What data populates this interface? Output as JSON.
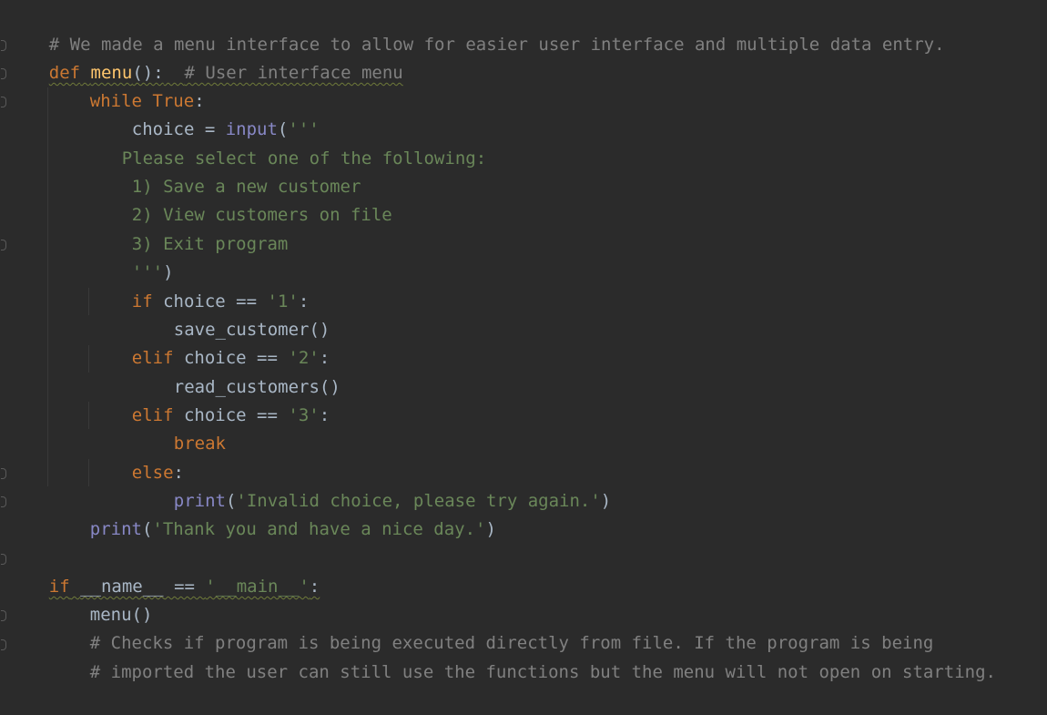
{
  "code": {
    "comment_top": "# We made a menu interface to allow for easier user interface and multiple data entry.",
    "def_kw": "def",
    "def_name": "menu",
    "def_parens": "():",
    "def_comment": "# User interface menu",
    "while_kw": "while",
    "while_true": "True",
    "while_colon": ":",
    "choice_assign": "choice = ",
    "input_fn": "input",
    "input_open": "(",
    "triple_open": "'''",
    "prompt_line1": "Please select one of the following:",
    "prompt_line2": "1) Save a new customer",
    "prompt_line3": "2) View customers on file",
    "prompt_line4": "3) Exit program",
    "triple_close": "'''",
    "close_paren": ")",
    "if_kw": "if",
    "cond_choice": " choice == ",
    "val1": "'1'",
    "colon": ":",
    "save_call": "save_customer()",
    "elif_kw": "elif",
    "val2": "'2'",
    "read_call": "read_customers()",
    "val3": "'3'",
    "break_kw": "break",
    "else_kw": "else",
    "print_fn": "print",
    "invalid_str": "'Invalid choice, please try again.'",
    "thanks_str": "'Thank you and have a nice day.'",
    "main_if": "if",
    "main_name": "__name__",
    "main_eq": " == ",
    "main_str": "'__main__'",
    "menu_call": "menu()",
    "comment_b1": "# Checks if program is being executed directly from file. If the program is being",
    "comment_b2": "# imported the user can still use the functions but the menu will not open on starting."
  },
  "colors": {
    "background": "#2b2b2b",
    "keyword": "#cc7832",
    "function_name": "#ffc66d",
    "string": "#6a8759",
    "comment": "#808080",
    "builtin": "#8888c6",
    "text": "#a9b7c6"
  }
}
